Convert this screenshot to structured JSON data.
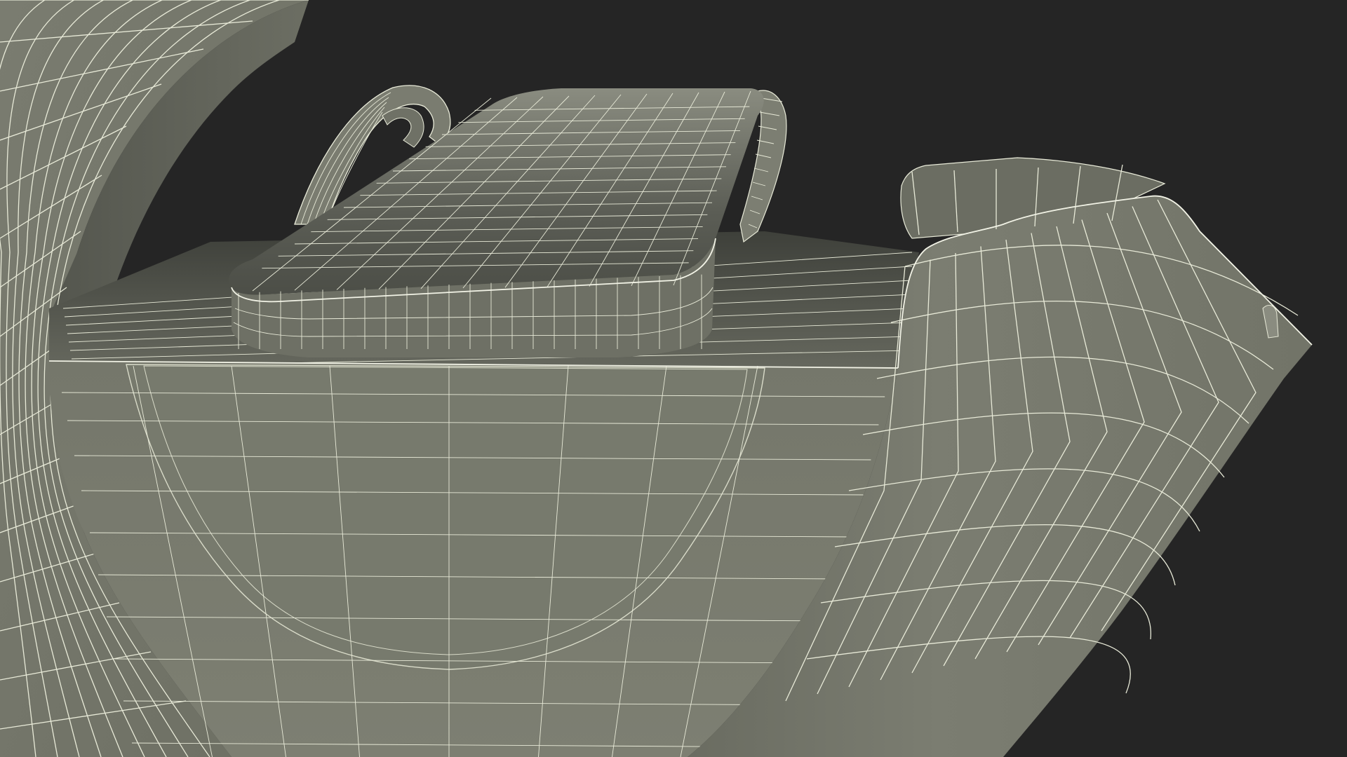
{
  "scene": {
    "background_color": "#252525",
    "mesh_fill_color": "#797b6e",
    "mesh_shadow_color": "#55574f",
    "wire_color": "#e8ead8"
  }
}
